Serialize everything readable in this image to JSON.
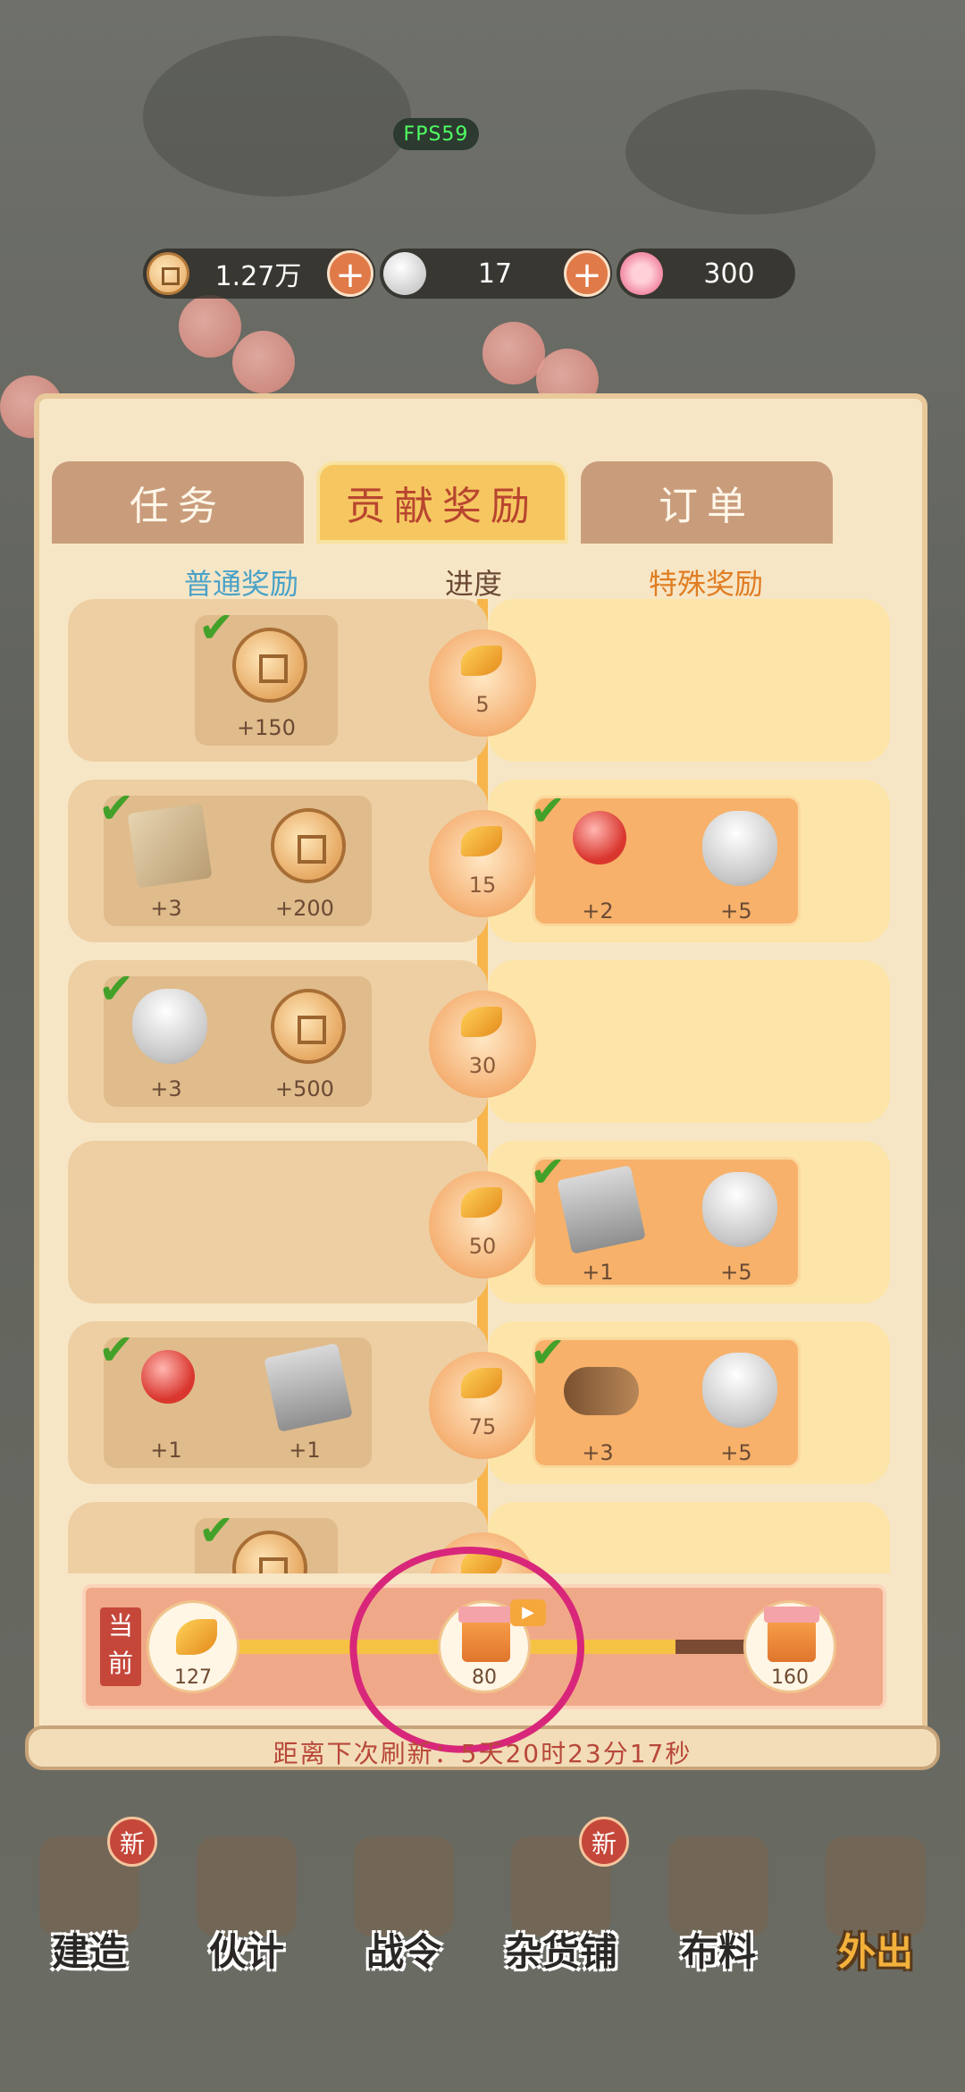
{
  "fps": "FPS59",
  "currencies": [
    {
      "icon": "copper-coin-icon",
      "value": "1.27万"
    },
    {
      "icon": "silver-ingot-icon",
      "value": "17"
    },
    {
      "icon": "blossom-icon",
      "value": "300"
    }
  ],
  "tabs": [
    {
      "label": "任务",
      "active": false
    },
    {
      "label": "贡献奖励",
      "active": true
    },
    {
      "label": "订单",
      "active": false
    }
  ],
  "columns": {
    "normal": "普通奖励",
    "progress": "进度",
    "special": "特殊奖励"
  },
  "colors": {
    "normal_header": "#4aa2c8",
    "progress_header": "#6b4a35",
    "special_header": "#e07d22"
  },
  "rows": [
    {
      "threshold": "5",
      "normal": [
        {
          "icon": "copper-coin-icon",
          "qty": "+150",
          "claimed": true
        }
      ],
      "special": []
    },
    {
      "threshold": "15",
      "normal": [
        {
          "icon": "cloth-icon",
          "qty": "+3",
          "claimed": true
        },
        {
          "icon": "copper-coin-icon",
          "qty": "+200",
          "claimed": false
        }
      ],
      "special": [
        {
          "icon": "pearl-icon",
          "qty": "+2",
          "claimed": true
        },
        {
          "icon": "silver-ingot-icon",
          "qty": "+5",
          "claimed": false
        }
      ]
    },
    {
      "threshold": "30",
      "normal": [
        {
          "icon": "silver-ingot-icon",
          "qty": "+3",
          "claimed": true
        },
        {
          "icon": "copper-coin-icon",
          "qty": "+500",
          "claimed": false
        }
      ],
      "special": []
    },
    {
      "threshold": "50",
      "normal": [],
      "special": [
        {
          "icon": "book-icon",
          "qty": "+1",
          "claimed": true
        },
        {
          "icon": "silver-ingot-icon",
          "qty": "+5",
          "claimed": false
        }
      ]
    },
    {
      "threshold": "75",
      "normal": [
        {
          "icon": "pearl-icon",
          "qty": "+1",
          "claimed": true
        },
        {
          "icon": "book-icon",
          "qty": "+1",
          "claimed": false
        }
      ],
      "special": [
        {
          "icon": "log-icon",
          "qty": "+3",
          "claimed": true
        },
        {
          "icon": "silver-ingot-icon",
          "qty": "+5",
          "claimed": false
        }
      ]
    },
    {
      "threshold": "",
      "normal": [
        {
          "icon": "copper-coin-icon",
          "qty": "",
          "claimed": true
        }
      ],
      "special": []
    }
  ],
  "current": {
    "label": "当前",
    "value": "127",
    "milestones": [
      {
        "value": "80",
        "has_video": true
      },
      {
        "value": "160",
        "has_video": false
      }
    ],
    "progress_fraction": 0.79
  },
  "refresh_text": "距离下次刷新：5天20时23分17秒",
  "nav": [
    {
      "label": "建造",
      "new": true,
      "badge": "新"
    },
    {
      "label": "伙计",
      "new": false,
      "badge": ""
    },
    {
      "label": "战令",
      "new": false,
      "badge": ""
    },
    {
      "label": "杂货铺",
      "new": true,
      "badge": "新"
    },
    {
      "label": "布料",
      "new": false,
      "badge": ""
    },
    {
      "label": "外出",
      "new": false,
      "badge": ""
    }
  ]
}
